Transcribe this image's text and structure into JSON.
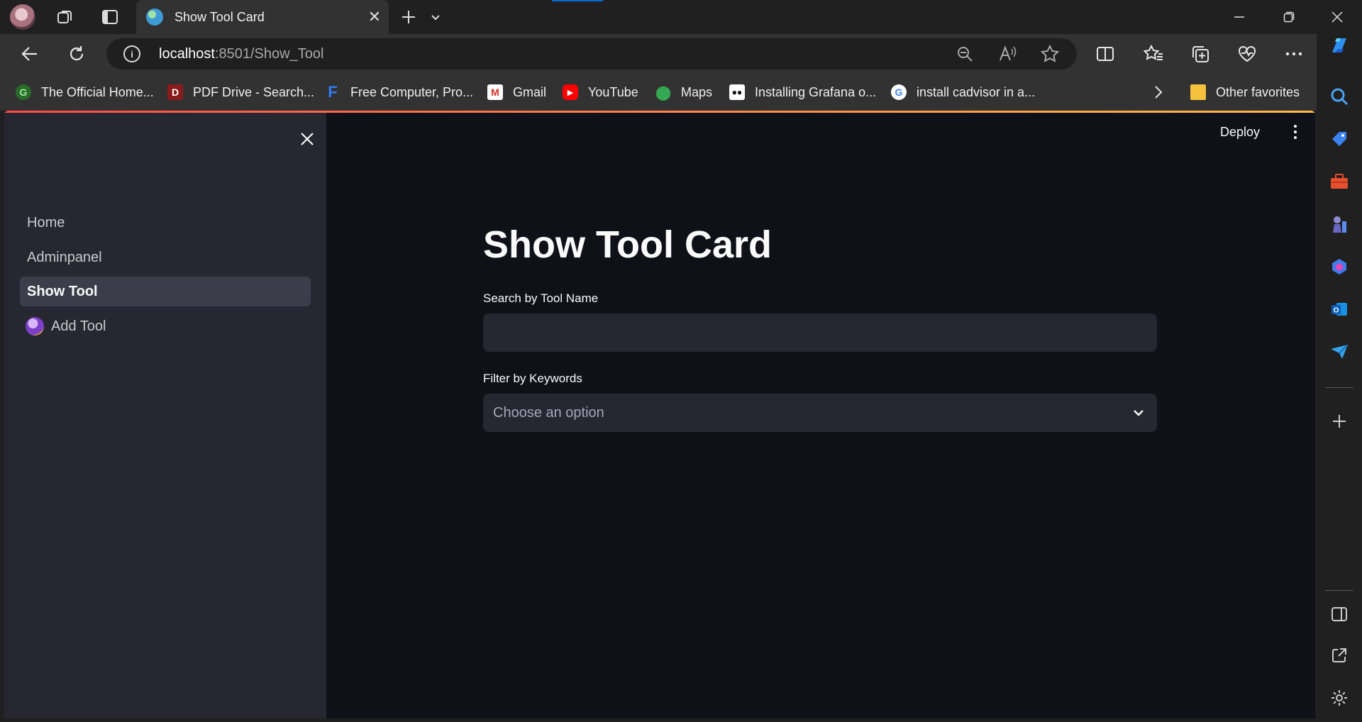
{
  "browser": {
    "tab_title": "Show Tool Card",
    "url_host": "localhost",
    "url_path": ":8501/Show_Tool",
    "favorites": [
      {
        "label": "The Official Home...",
        "icon": "osgeo-favicon"
      },
      {
        "label": "PDF Drive - Search...",
        "icon": "pdfdrive-favicon"
      },
      {
        "label": "Free Computer, Pro...",
        "icon": "f-favicon"
      },
      {
        "label": "Gmail",
        "icon": "gmail-favicon"
      },
      {
        "label": "YouTube",
        "icon": "youtube-favicon"
      },
      {
        "label": "Maps",
        "icon": "maps-favicon"
      },
      {
        "label": "Installing Grafana o...",
        "icon": "medium-favicon"
      },
      {
        "label": "install cadvisor in a...",
        "icon": "google-favicon"
      }
    ],
    "other_favorites": "Other favorites"
  },
  "app": {
    "sidebar": {
      "items": [
        {
          "label": "Home"
        },
        {
          "label": "Adminpanel"
        },
        {
          "label": "Show Tool"
        },
        {
          "label": "Add Tool"
        }
      ]
    },
    "header": {
      "deploy_label": "Deploy"
    },
    "main": {
      "title": "Show Tool Card",
      "search_label": "Search by Tool Name",
      "search_value": "",
      "filter_label": "Filter by Keywords",
      "filter_placeholder": "Choose an option"
    }
  },
  "colors": {
    "app_background": "#0e1117",
    "sidebar_background": "#262730",
    "input_background": "#262730",
    "decoration_gradient_start": "#ff4b4b",
    "decoration_gradient_end": "#ffbd45"
  }
}
